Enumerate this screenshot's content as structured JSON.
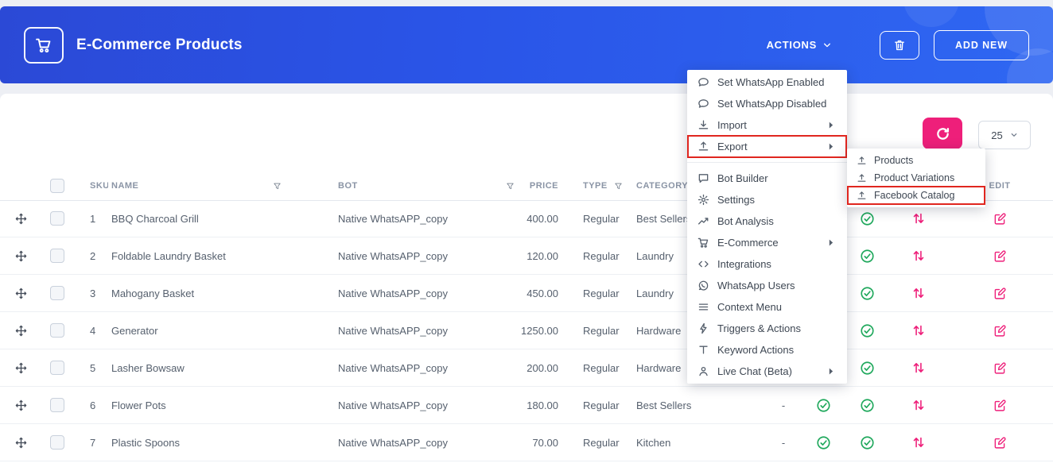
{
  "header": {
    "title": "E-Commerce Products",
    "actions_label": "ACTIONS",
    "add_new_label": "ADD NEW"
  },
  "toolbar": {
    "page_size": "25"
  },
  "actions_menu": {
    "items": [
      {
        "label": "Set WhatsApp Enabled",
        "icon": "chat"
      },
      {
        "label": "Set WhatsApp Disabled",
        "icon": "chat"
      },
      {
        "label": "Import",
        "icon": "download",
        "submenu": true
      },
      {
        "label": "Export",
        "icon": "upload",
        "submenu": true,
        "highlighted": true
      },
      {
        "label": "Bot Builder",
        "icon": "chat-square",
        "divider_before": true
      },
      {
        "label": "Settings",
        "icon": "gear"
      },
      {
        "label": "Bot Analysis",
        "icon": "trend"
      },
      {
        "label": "E-Commerce",
        "icon": "cart",
        "submenu": true
      },
      {
        "label": "Integrations",
        "icon": "code"
      },
      {
        "label": "WhatsApp Users",
        "icon": "whatsapp"
      },
      {
        "label": "Context Menu",
        "icon": "list"
      },
      {
        "label": "Triggers & Actions",
        "icon": "bolt"
      },
      {
        "label": "Keyword Actions",
        "icon": "text"
      },
      {
        "label": "Live Chat (Beta)",
        "icon": "person",
        "submenu": true
      }
    ]
  },
  "export_submenu": {
    "items": [
      {
        "label": "Products",
        "icon": "upload"
      },
      {
        "label": "Product Variations",
        "icon": "upload"
      },
      {
        "label": "Facebook Catalog",
        "icon": "upload",
        "highlighted": true
      }
    ]
  },
  "table": {
    "columns": {
      "sku": "SKU",
      "name": "NAME",
      "bot": "BOT",
      "price": "PRICE",
      "type": "TYPE",
      "category": "CATEGORY",
      "edit": "EDIT"
    },
    "rows": [
      {
        "sku": "1",
        "name": "BBQ Charcoal Grill",
        "bot": "Native WhatsAPP_copy",
        "price": "400.00",
        "type": "Regular",
        "category": "Best Sellers",
        "image": "-"
      },
      {
        "sku": "2",
        "name": "Foldable Laundry Basket",
        "bot": "Native WhatsAPP_copy",
        "price": "120.00",
        "type": "Regular",
        "category": "Laundry",
        "image": "-"
      },
      {
        "sku": "3",
        "name": "Mahogany Basket",
        "bot": "Native WhatsAPP_copy",
        "price": "450.00",
        "type": "Regular",
        "category": "Laundry",
        "image": "-"
      },
      {
        "sku": "4",
        "name": "Generator",
        "bot": "Native WhatsAPP_copy",
        "price": "1250.00",
        "type": "Regular",
        "category": "Hardware",
        "image": "-"
      },
      {
        "sku": "5",
        "name": "Lasher Bowsaw",
        "bot": "Native WhatsAPP_copy",
        "price": "200.00",
        "type": "Regular",
        "category": "Hardware",
        "image": "-"
      },
      {
        "sku": "6",
        "name": "Flower Pots",
        "bot": "Native WhatsAPP_copy",
        "price": "180.00",
        "type": "Regular",
        "category": "Best Sellers",
        "image": "-"
      },
      {
        "sku": "7",
        "name": "Plastic Spoons",
        "bot": "Native WhatsAPP_copy",
        "price": "70.00",
        "type": "Regular",
        "category": "Kitchen",
        "image": "-"
      }
    ]
  },
  "colors": {
    "header_blue": "#2a55e8",
    "accent_pink": "#ee1f7a",
    "success_green": "#1fa85c",
    "highlight_red": "#e0261f"
  }
}
